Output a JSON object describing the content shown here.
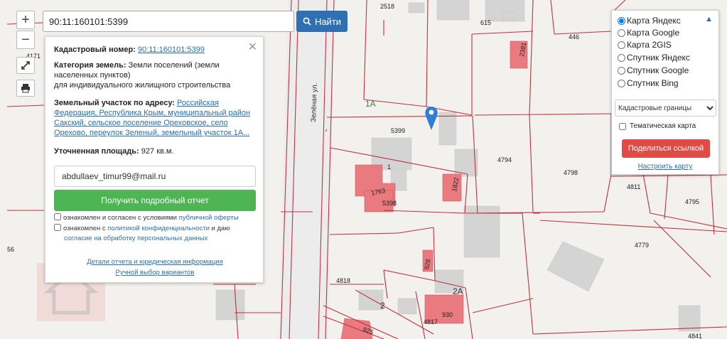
{
  "search": {
    "value": "90:11:160101:5399",
    "button_label": "Найти"
  },
  "zoom": {
    "in_label": "+",
    "out_label": "−"
  },
  "info": {
    "cadastral_label": "Кадастровый номер:",
    "cadastral_value": "90:11:160101:5399",
    "category_label": "Категория земель:",
    "category_value": "Земли поселений (земли населенных пунктов)",
    "category_value_2": "для индивидуального жилищного строительства",
    "address_label": "Земельный участок по адресу:",
    "address_l1": "Российская",
    "address_l2": "Федерация, Республика Крым, муниципальный район",
    "address_l3": "Сакский, сельское поселение Ореховское, село",
    "address_l4": "Орехово, переулок Зеленый, земельный участок 1А...",
    "area_label": "Уточненная площадь:",
    "area_value": "927 кв.м.",
    "email_value": "abdullaev_timur99@mail.ru",
    "report_button": "Получить подробный отчет",
    "consent1_a": "ознакомлен и согласен с условиями ",
    "consent1_link": "публичной оферты",
    "consent2_a": "ознакомлен с ",
    "consent2_link": "политикой конфиденциальности",
    "consent2_b": " и даю",
    "consent2_link2": "согласие на обработку персональных данных",
    "footer_link1": "Детали отчета и юридическая информация",
    "footer_link2": "Ручной выбор вариантов"
  },
  "layers": {
    "options": [
      "Карта Яндекс",
      "Карта Google",
      "Карта 2GIS",
      "Спутник Яндекс",
      "Спутник Google",
      "Спутник Bing"
    ],
    "selected": "Карта Яндекс",
    "cadastral_select": "Кадастровые границы",
    "thematic_label": "Тематическая карта",
    "share_button": "Поделиться ссылкой",
    "setup_link": "Настроить карту"
  },
  "map_labels": {
    "street": "Зелёная ул.",
    "parcel_main": "1А",
    "parcel_2a": "2А",
    "parcel_1": "1",
    "parcel_2": "2",
    "n2518": "2518",
    "n615": "615",
    "n446": "446",
    "n2381": "2381",
    "n5399": "5399",
    "n4794": "4794",
    "n4798": "4798",
    "n4811": "4811",
    "n4795": "4795",
    "n1763": "1763",
    "n5398": "5398",
    "n1822": "1822",
    "n4779": "4779",
    "n4818": "4818",
    "n928": "928",
    "n930": "930",
    "n4817": "4817",
    "n925": "925",
    "n4841": "4841",
    "n4171": "4171",
    "n56": "56"
  },
  "colors": {
    "accent_blue": "#2f6fb3",
    "green_button": "#4fb453",
    "red_button": "#df4b45",
    "parcel_line": "#c0313f",
    "building_fill": "#e87a80",
    "marker": "#2f7fd2"
  }
}
